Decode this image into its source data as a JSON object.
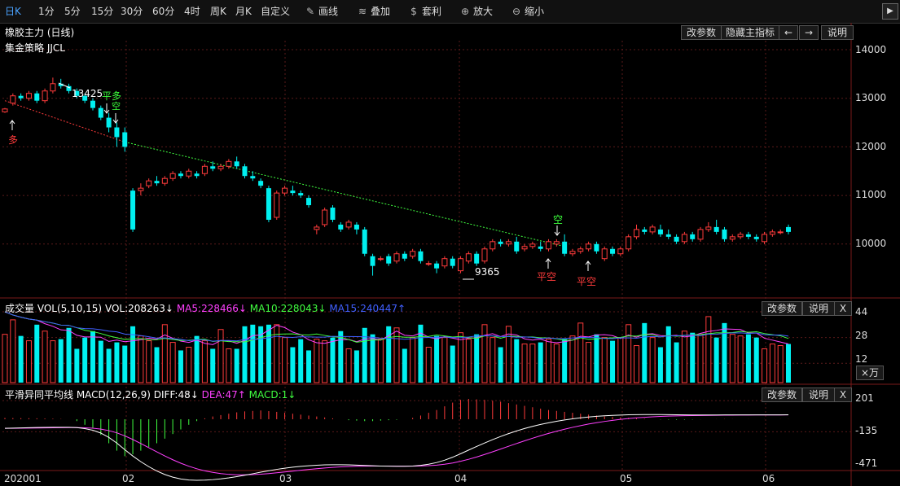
{
  "toolbar": {
    "periods": [
      {
        "label": "日K",
        "active": true
      },
      {
        "label": "1分"
      },
      {
        "label": "5分"
      },
      {
        "label": "15分"
      },
      {
        "label": "30分"
      },
      {
        "label": "60分"
      },
      {
        "label": "4时"
      },
      {
        "label": "周K"
      },
      {
        "label": "月K"
      },
      {
        "label": "自定义"
      }
    ],
    "tools": [
      {
        "label": "画线",
        "icon": "pencil-icon"
      },
      {
        "label": "叠加",
        "icon": "stack-icon"
      },
      {
        "label": "套利",
        "icon": "money-bag-icon"
      },
      {
        "label": "放大",
        "icon": "zoom-in-icon"
      },
      {
        "label": "缩小",
        "icon": "zoom-out-icon"
      }
    ]
  },
  "main_panel": {
    "title": "橡胶主力 (日线)",
    "strategy": "集金策略 JJCL",
    "buttons": {
      "params": "改参数",
      "hide": "隐藏主指标",
      "prev": "←",
      "next": "→",
      "help": "说明"
    },
    "yaxis_labels": [
      "14000",
      "13000",
      "12000",
      "11000",
      "10000"
    ],
    "annotations": {
      "high_value": "13425",
      "low_value": "9365",
      "long_signal": "多",
      "close_long_signal": "平多",
      "short_signal_1": "空",
      "short_signal_2": "空",
      "close_short_1": "平空",
      "close_short_2": "平空"
    }
  },
  "volume_panel": {
    "title": "成交量 VOL(5,10,15)",
    "vol": "VOL:208263↓",
    "ma5": "MA5:228466↓",
    "ma10": "MA10:228043↓",
    "ma15": "MA15:240447↑",
    "buttons": {
      "params": "改参数",
      "help": "说明",
      "close": "X"
    },
    "yaxis_labels": [
      "44",
      "28",
      "12"
    ],
    "unit": "×万"
  },
  "macd_panel": {
    "title": "平滑异同平均线 MACD(12,26,9)",
    "diff": "DIFF:48↓",
    "dea": "DEA:47↑",
    "macd": "MACD:1↓",
    "buttons": {
      "params": "改参数",
      "help": "说明",
      "close": "X"
    },
    "yaxis_labels": [
      "201",
      "-135",
      "-471"
    ]
  },
  "xaxis_labels": [
    "202001",
    "02",
    "03",
    "04",
    "05",
    "06"
  ],
  "colors": {
    "up": "#ff3b3b",
    "down": "#00f0f0",
    "ma5": "#ff40ff",
    "ma10": "#40ff40",
    "ma15": "#4060ff",
    "grid": "#5a1a1a"
  },
  "chart_data": {
    "type": "candlestick",
    "title": "橡胶主力 (日线)",
    "ylim": [
      9000,
      14200
    ],
    "candles": [
      [
        12720,
        12780,
        12700,
        12800
      ],
      [
        12900,
        13050,
        12850,
        13100
      ],
      [
        13050,
        13000,
        12950,
        13100
      ],
      [
        13000,
        13100,
        12950,
        13150
      ],
      [
        13100,
        12950,
        12900,
        13150
      ],
      [
        12950,
        13150,
        12900,
        13200
      ],
      [
        13150,
        13300,
        13100,
        13425
      ],
      [
        13300,
        13250,
        13200,
        13400
      ],
      [
        13250,
        13150,
        13100,
        13300
      ],
      [
        13150,
        13050,
        13000,
        13200
      ],
      [
        13050,
        12950,
        12900,
        13100
      ],
      [
        12950,
        12800,
        12750,
        13000
      ],
      [
        12800,
        12600,
        12550,
        12850
      ],
      [
        12600,
        12400,
        12300,
        12700
      ],
      [
        12400,
        12200,
        12000,
        12500
      ],
      [
        12300,
        12000,
        11900,
        12400
      ],
      [
        11100,
        10300,
        10250,
        11150
      ],
      [
        11100,
        11150,
        11000,
        11250
      ],
      [
        11200,
        11300,
        11150,
        11350
      ],
      [
        11300,
        11250,
        11200,
        11400
      ],
      [
        11250,
        11350,
        11200,
        11400
      ],
      [
        11350,
        11450,
        11300,
        11500
      ],
      [
        11450,
        11400,
        11350,
        11500
      ],
      [
        11400,
        11500,
        11350,
        11550
      ],
      [
        11450,
        11400,
        11350,
        11500
      ],
      [
        11450,
        11600,
        11400,
        11650
      ],
      [
        11600,
        11550,
        11500,
        11700
      ],
      [
        11550,
        11600,
        11500,
        11650
      ],
      [
        11600,
        11700,
        11550,
        11750
      ],
      [
        11700,
        11600,
        11550,
        11800
      ],
      [
        11600,
        11400,
        11350,
        11650
      ],
      [
        11400,
        11350,
        11300,
        11500
      ],
      [
        11300,
        11200,
        11150,
        11350
      ],
      [
        11150,
        10500,
        10450,
        11200
      ],
      [
        10550,
        11050,
        10500,
        11100
      ],
      [
        11050,
        11150,
        11000,
        11200
      ],
      [
        11100,
        11050,
        11000,
        11200
      ],
      [
        11050,
        11000,
        10950,
        11100
      ],
      [
        10950,
        10800,
        10750,
        11000
      ],
      [
        10300,
        10350,
        10200,
        10400
      ],
      [
        10400,
        10700,
        10350,
        10750
      ],
      [
        10750,
        10500,
        10450,
        10800
      ],
      [
        10400,
        10300,
        10250,
        10450
      ],
      [
        10350,
        10450,
        10300,
        10500
      ],
      [
        10400,
        10300,
        10200,
        10450
      ],
      [
        10300,
        9800,
        9750,
        10350
      ],
      [
        9750,
        9550,
        9350,
        9800
      ],
      [
        9700,
        9700,
        9650,
        9750
      ],
      [
        9750,
        9600,
        9550,
        9800
      ],
      [
        9650,
        9800,
        9600,
        9850
      ],
      [
        9800,
        9700,
        9650,
        9850
      ],
      [
        9750,
        9850,
        9700,
        9900
      ],
      [
        9850,
        9650,
        9600,
        9900
      ],
      [
        9600,
        9600,
        9550,
        9650
      ],
      [
        9600,
        9500,
        9400,
        9650
      ],
      [
        9550,
        9700,
        9500,
        9750
      ],
      [
        9700,
        9550,
        9500,
        9750
      ],
      [
        9450,
        9700,
        9400,
        9750
      ],
      [
        9650,
        9800,
        9600,
        9850
      ],
      [
        9800,
        9600,
        9550,
        9850
      ],
      [
        9650,
        9900,
        9600,
        9950
      ],
      [
        9900,
        10050,
        9850,
        10100
      ],
      [
        10050,
        10000,
        9950,
        10100
      ],
      [
        10000,
        10050,
        9950,
        10100
      ],
      [
        10050,
        9850,
        9800,
        10150
      ],
      [
        9900,
        9950,
        9850,
        10000
      ],
      [
        9950,
        10000,
        9900,
        10050
      ],
      [
        9950,
        9900,
        9850,
        10050
      ],
      [
        9900,
        10050,
        9850,
        10100
      ],
      [
        10000,
        10050,
        9950,
        10100
      ],
      [
        10050,
        9800,
        9750,
        10200
      ],
      [
        9800,
        9850,
        9750,
        9900
      ],
      [
        9850,
        9900,
        9800,
        9950
      ],
      [
        9900,
        10000,
        9850,
        10050
      ],
      [
        10000,
        9850,
        9800,
        10050
      ],
      [
        9700,
        9900,
        9650,
        9950
      ],
      [
        9900,
        9800,
        9750,
        9950
      ],
      [
        9800,
        9900,
        9750,
        9950
      ],
      [
        9900,
        10150,
        9850,
        10200
      ],
      [
        10150,
        10300,
        10100,
        10400
      ],
      [
        10300,
        10250,
        10200,
        10350
      ],
      [
        10250,
        10350,
        10200,
        10400
      ],
      [
        10300,
        10200,
        10150,
        10400
      ],
      [
        10200,
        10150,
        10100,
        10300
      ],
      [
        10150,
        10050,
        10000,
        10200
      ],
      [
        10050,
        10200,
        10000,
        10250
      ],
      [
        10200,
        10100,
        10050,
        10250
      ],
      [
        10100,
        10300,
        10050,
        10350
      ],
      [
        10300,
        10350,
        10250,
        10450
      ],
      [
        10350,
        10250,
        10200,
        10500
      ],
      [
        10300,
        10100,
        10050,
        10350
      ],
      [
        10100,
        10150,
        10050,
        10200
      ],
      [
        10150,
        10200,
        10100,
        10250
      ],
      [
        10200,
        10150,
        10100,
        10250
      ],
      [
        10150,
        10100,
        10050,
        10200
      ],
      [
        10050,
        10200,
        10000,
        10250
      ],
      [
        10200,
        10250,
        10150,
        10300
      ],
      [
        10250,
        10250,
        10200,
        10300
      ],
      [
        10350,
        10250,
        10200,
        10400
      ]
    ],
    "volume": [
      30,
      39,
      29,
      26,
      36,
      32,
      26,
      27,
      34,
      21,
      28,
      32,
      26,
      21,
      25,
      23,
      35,
      29,
      26,
      22,
      36,
      25,
      20,
      22,
      29,
      26,
      21,
      33,
      21,
      21,
      35,
      36,
      35,
      36,
      36,
      28,
      22,
      27,
      20,
      27,
      26,
      28,
      32,
      21,
      20,
      34,
      30,
      27,
      35,
      34,
      21,
      28,
      36,
      22,
      29,
      28,
      23,
      31,
      27,
      30,
      36,
      28,
      22,
      35,
      27,
      24,
      24,
      25,
      27,
      24,
      27,
      29,
      37,
      25,
      30,
      28,
      26,
      28,
      36,
      23,
      37,
      28,
      22,
      35,
      25,
      32,
      31,
      30,
      41,
      28,
      37,
      30,
      29,
      30,
      28,
      21,
      24,
      23,
      24
    ],
    "macd_hist": [
      14,
      13,
      12,
      11,
      10,
      8,
      6,
      3,
      0,
      -20,
      -60,
      -100,
      -170,
      -260,
      -340,
      -400,
      -380,
      -340,
      -300,
      -260,
      -210,
      -160,
      -110,
      -60,
      -20,
      10,
      30,
      45,
      60,
      75,
      85,
      90,
      95,
      88,
      80,
      70,
      60,
      50,
      40,
      30,
      20,
      10,
      0,
      -10,
      -15,
      -20,
      -20,
      -15,
      -10,
      -5,
      0,
      15,
      40,
      70,
      100,
      140,
      180,
      210,
      220,
      215,
      210,
      200,
      190,
      175,
      160,
      145,
      130,
      115,
      100,
      90,
      80,
      70,
      60,
      50,
      40,
      30,
      25,
      20,
      15,
      10,
      5,
      0,
      -3,
      -5,
      -6,
      -5,
      -3,
      -1,
      0,
      1,
      2,
      1,
      0,
      1,
      0,
      1,
      0,
      1,
      1
    ]
  }
}
